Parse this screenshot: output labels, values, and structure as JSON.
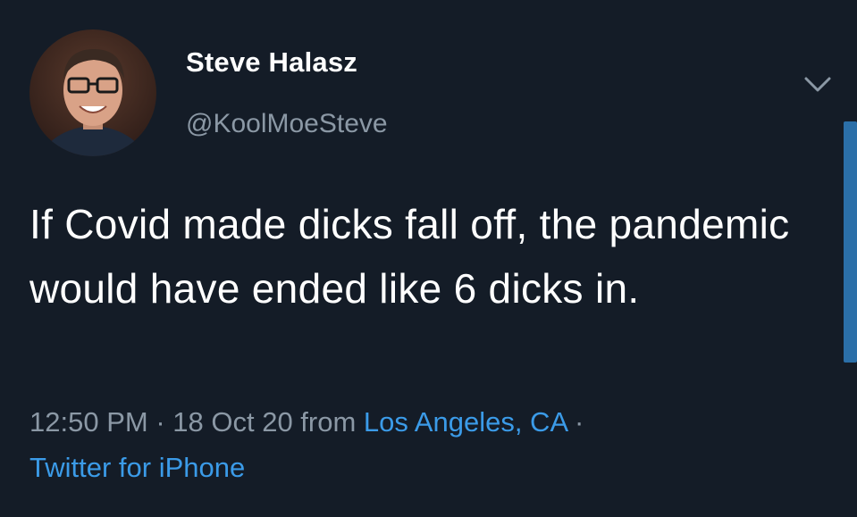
{
  "tweet": {
    "author": {
      "display_name": "Steve Halasz",
      "handle": "@KoolMoeSteve",
      "avatar_icon": "profile-photo"
    },
    "menu_icon": "chevron-down-icon",
    "text": "If Covid made dicks fall off, the pandemic would have ended like 6 dicks in.",
    "meta": {
      "time": "12:50 PM",
      "separator": " · ",
      "date": "18 Oct 20",
      "from_label": " from ",
      "location": "Los Angeles, CA",
      "trailing_separator": " ·",
      "source": "Twitter for iPhone"
    },
    "colors": {
      "background": "#141c27",
      "text": "#ffffff",
      "secondary": "#8b98a5",
      "link": "#3b9be8",
      "scrollbar": "#2b6fa8"
    }
  }
}
